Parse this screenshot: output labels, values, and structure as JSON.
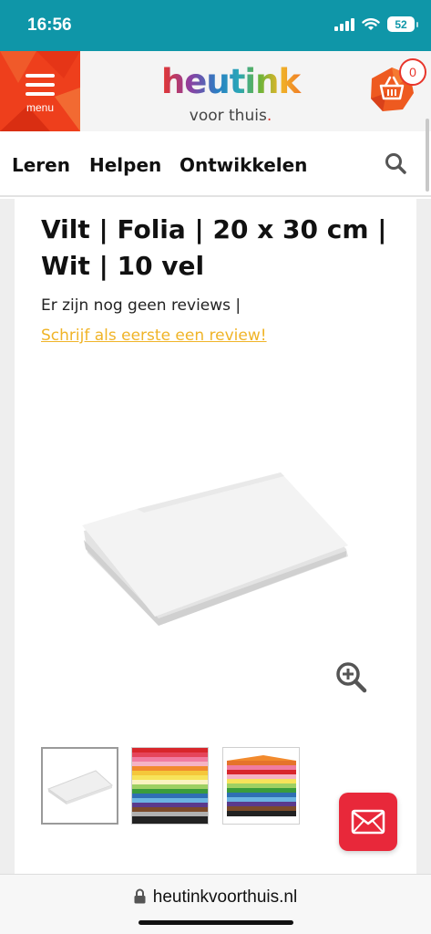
{
  "status_bar": {
    "time": "16:56",
    "battery": "52"
  },
  "header": {
    "menu_label": "menu",
    "logo_word": "heutink",
    "logo_tagline": "voor thuis",
    "logo_tagline_dot": ".",
    "cart_count": "0",
    "brand_red": "#ee3f1c",
    "teal": "#0f96a8"
  },
  "nav": {
    "items": [
      "Leren",
      "Helpen",
      "Ontwikkelen"
    ],
    "search_icon": "search-icon"
  },
  "product": {
    "title": "Vilt | Folia | 20 x 30 cm | Wit | 10 vel",
    "reviews_text": "Er zijn nog geen reviews |",
    "write_review_link": "Schrijf als eerste een review!",
    "link_color": "#f0b428"
  },
  "gallery": {
    "thumbnails": [
      "white felt sheets",
      "rainbow felt stack front",
      "rainbow felt stack angled"
    ],
    "active_index": 0
  },
  "url_bar": {
    "url": "heutinkvoorthuis.nl"
  }
}
